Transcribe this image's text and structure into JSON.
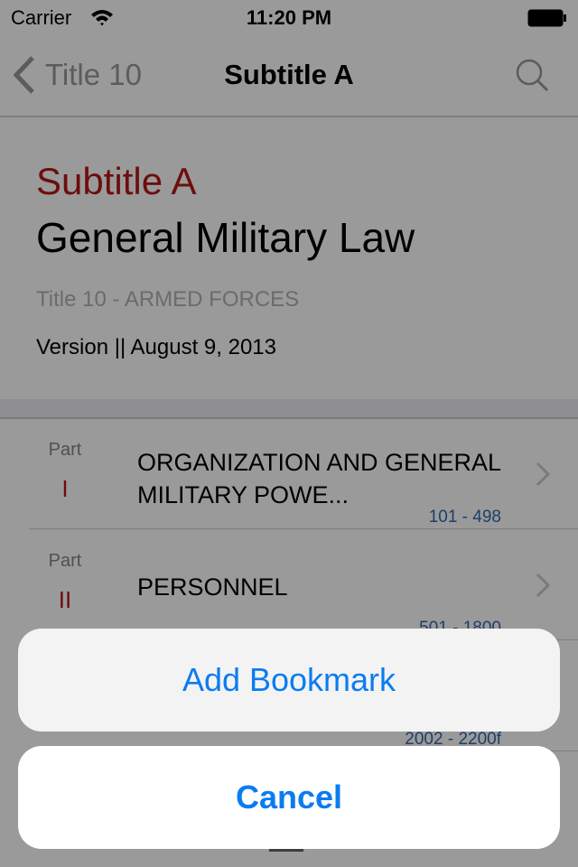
{
  "status_bar": {
    "carrier": "Carrier",
    "time": "11:20 PM"
  },
  "nav": {
    "back_label": "Title 10",
    "title": "Subtitle A"
  },
  "header": {
    "subtitle": "Subtitle A",
    "title": "General Military Law",
    "parent_title": "Title 10 - ARMED FORCES",
    "version": "Version || August 9, 2013"
  },
  "parts": [
    {
      "label": "Part",
      "number": "I",
      "title": "ORGANIZATION AND GENERAL MILITARY POWE...",
      "range": "101 - 498"
    },
    {
      "label": "Part",
      "number": "II",
      "title": "PERSONNEL",
      "range": "501 - 1800"
    },
    {
      "label": "",
      "number": "",
      "title": "",
      "range": "2002 - 2200f"
    }
  ],
  "action_sheet": {
    "add_label": "Add Bookmark",
    "cancel_label": "Cancel"
  },
  "colors": {
    "accent": "#0b7cf0",
    "part_number": "#6e0d0d",
    "range": "#1d3f66"
  }
}
